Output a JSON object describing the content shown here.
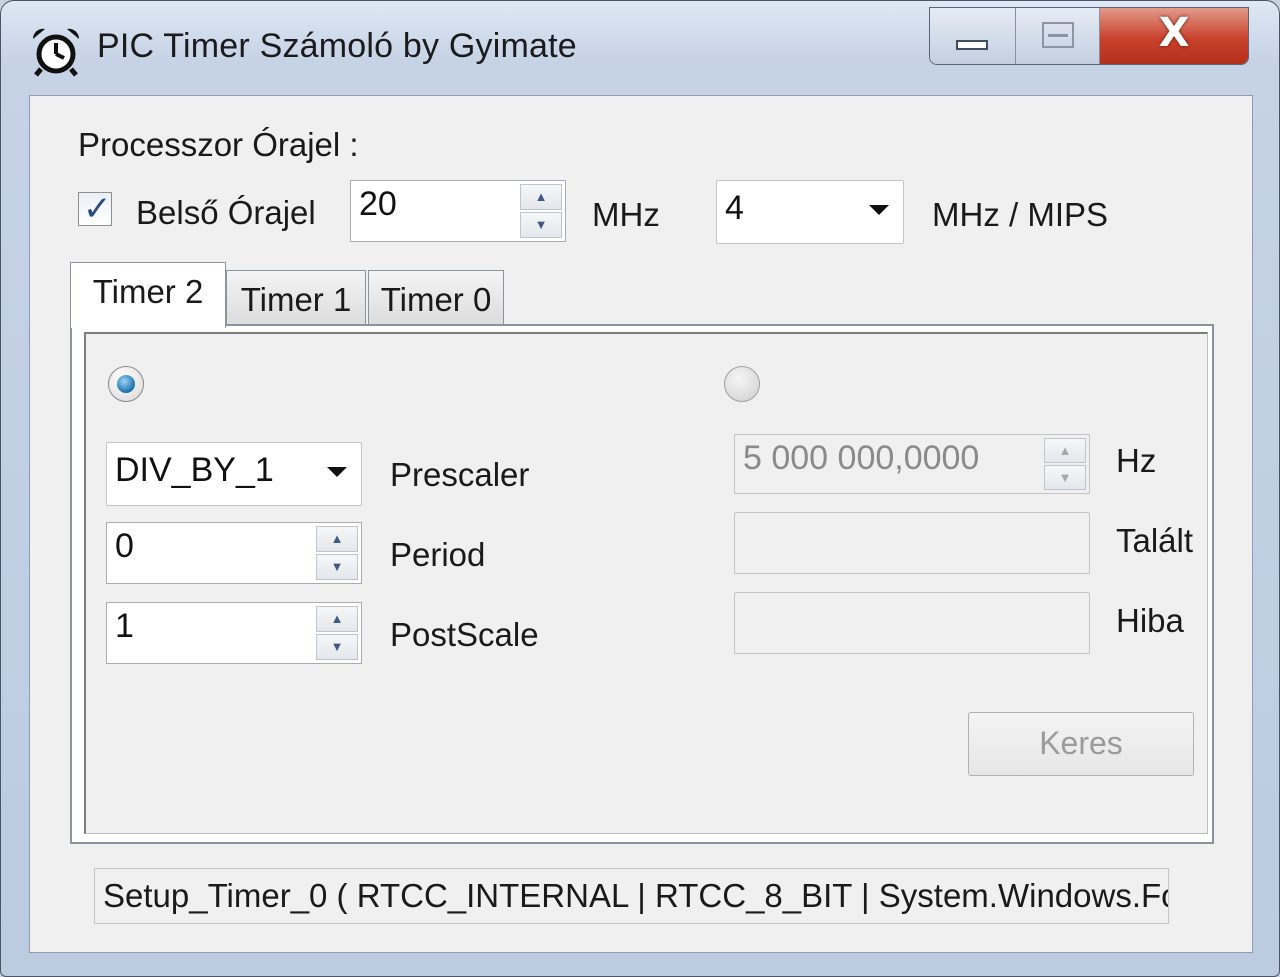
{
  "window": {
    "title": "PIC Timer Számoló by Gyimate",
    "icon": "alarm-clock-icon"
  },
  "caption_buttons": {
    "close_glyph": "X"
  },
  "clock": {
    "section_label": "Processzor Órajel :",
    "internal_clock": {
      "label": "Belső Órajel",
      "checked": true,
      "check_glyph": "✓"
    },
    "frequency_value": "20",
    "frequency_unit": "MHz",
    "mips_divider": "4",
    "mips_unit": "MHz / MIPS"
  },
  "tabs": [
    {
      "label": "Timer 2",
      "active": true
    },
    {
      "label": "Timer 1",
      "active": false
    },
    {
      "label": "Timer 0",
      "active": false
    }
  ],
  "timer_panel": {
    "left_radio_selected": true,
    "right_radio_selected": false,
    "prescaler": {
      "value": "DIV_BY_1",
      "label": "Prescaler"
    },
    "period": {
      "value": "0",
      "label": "Period"
    },
    "postscale": {
      "value": "1",
      "label": "PostScale"
    },
    "target_frequency": {
      "value": "5 000 000,0000",
      "unit": "Hz",
      "enabled": false
    },
    "found": {
      "value": "",
      "label": "Talált"
    },
    "error": {
      "value": "",
      "label": "Hiba"
    },
    "search_button": {
      "label": "Keres",
      "enabled": false
    }
  },
  "spinner_arrows": {
    "up": "▲",
    "down": "▼"
  },
  "output": {
    "code_text": "Setup_Timer_0 ( RTCC_INTERNAL | RTCC_8_BIT | System.Windows.Fo"
  }
}
